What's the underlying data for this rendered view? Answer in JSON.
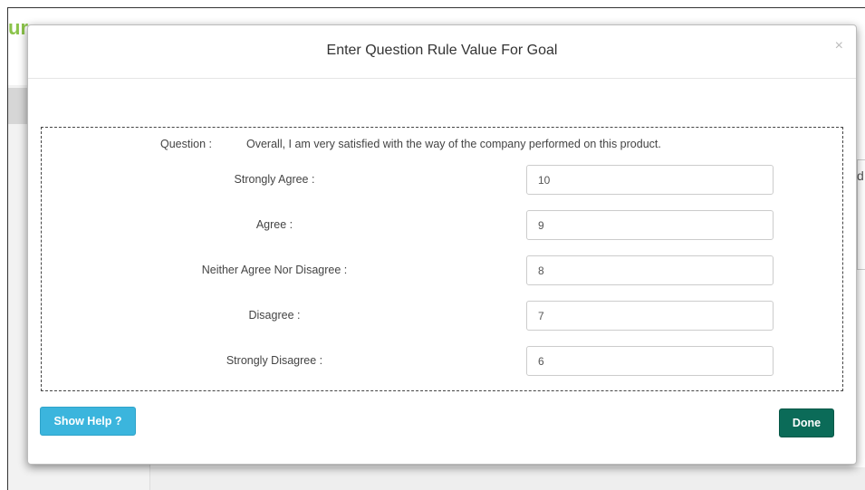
{
  "background": {
    "logo_fragment": "ur",
    "right_fragment": "d"
  },
  "modal": {
    "title": "Enter Question Rule Value For Goal",
    "close_glyph": "×",
    "question": {
      "label": "Question :",
      "text": "Overall, I am very satisfied with the way of the company performed on this product."
    },
    "rules": [
      {
        "label": "Strongly Agree :",
        "value": "10"
      },
      {
        "label": "Agree :",
        "value": "9"
      },
      {
        "label": "Neither Agree Nor Disagree :",
        "value": "8"
      },
      {
        "label": "Disagree :",
        "value": "7"
      },
      {
        "label": "Strongly Disagree :",
        "value": "6"
      }
    ],
    "buttons": {
      "help_label": "Show Help ?",
      "done_label": "Done"
    }
  },
  "colors": {
    "help_button": "#3bb5dd",
    "done_button": "#0b6b58",
    "logo_green": "#8bc34a"
  },
  "icons": {
    "close": "close-icon"
  }
}
